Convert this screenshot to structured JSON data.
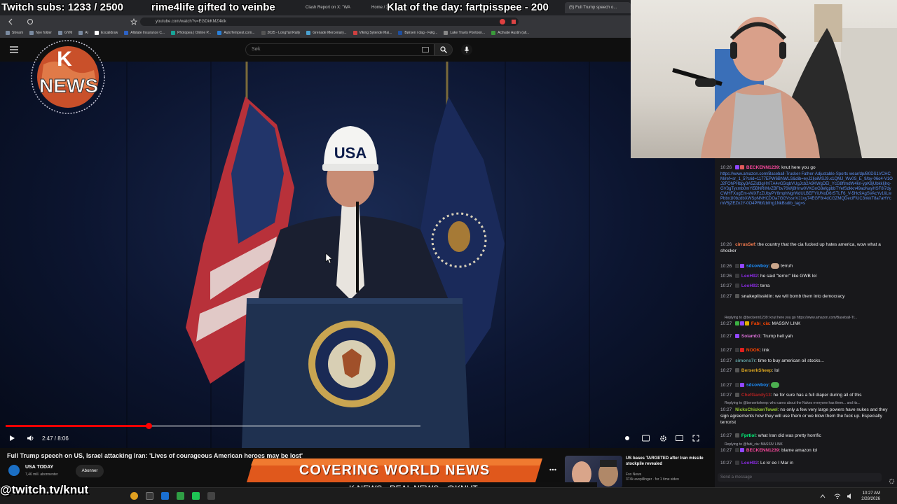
{
  "browser": {
    "tabs": [
      {
        "label": "Clash Report on X: \"WA"
      },
      {
        "label": "Home / X"
      },
      {
        "label": "(5) Full Trump speech o..."
      }
    ],
    "url": "youtube.com/watch?v=EGDkKMZ4klk",
    "bookmarks": [
      {
        "label": "Stream"
      },
      {
        "label": "Nye folder"
      },
      {
        "label": "GYM"
      },
      {
        "label": "AI"
      },
      {
        "label": "Excalidraw"
      },
      {
        "label": "Allstate Insurance C..."
      },
      {
        "label": "Photopea | Online P..."
      },
      {
        "label": "AutoTempest.com..."
      },
      {
        "label": "2025 - LongTail Rally"
      },
      {
        "label": "Grenade Mercenary..."
      },
      {
        "label": "Viking Sytende Mai..."
      },
      {
        "label": "Børsen i dag - Følg..."
      },
      {
        "label": "Lake Travis Pontoon..."
      },
      {
        "label": "Activate Austin (all..."
      }
    ]
  },
  "youtube": {
    "search_placeholder": "Søk",
    "player": {
      "time": "2:47 / 8:06",
      "progress": 0.344
    },
    "video_title": "Full Trump speech on US, Israel attacking Iran: 'Lives of courageous American heroes may be lost'",
    "channel": {
      "name": "USA TODAY",
      "subs": "7,46 mill. abonnenter"
    },
    "subscribe_label": "Abonner",
    "related": {
      "title": "US bases TARGETED after Iran missile stockpile revealed",
      "channel": "Fox News",
      "meta": "374k avspillinger · for 1 time siden"
    }
  },
  "overlays": {
    "subs_counter": "Twitch subs: 1233 / 2500",
    "gift_ticker": "rime4life gifted to veinbe",
    "klat": "Klat of the day: fartpisspee - 200",
    "logo_k": "K",
    "logo_news": "NEWS",
    "banner": "COVERING WORLD NEWS",
    "subbanner": "K NEWS - REAL NEWS - @KNUT",
    "twitch_handle": "@twitch.tv/knut",
    "hat_text": "USA"
  },
  "chat": {
    "messages": [
      {
        "time": "10:26",
        "user": "BECKENN1239",
        "color": "#ff4aa0",
        "text": "knut here you go"
      },
      {
        "time": "",
        "user": "",
        "color": "#5c8ff2",
        "text": "https://www.amazon.com/Baseball-Trucker-Father-Adjustable-Sports wear/dp/B0DS1VCHCM/ref=sr_1_5?crid=1177EPW6BNWLS&dib=eyJ2IjoiMSJ9.x1QMJ_Wv0S_E_9/by-06o4-V1OJ2FOhPHbpy3A5Zid3qHYi7A4vG5tqbVUgJcb2A9KWgDEl_YcG8ftmdW4kri-ypK8jUbkkIjIrq-GV3gTyxmb0mYi5BNRIMvZBFbv76Wj8Hnw0VKGnG8efgpbbTYefSdkkn49aoNayHSF8i7dyCWHFXugEm-vMXFzZUbyPY8mphNgrWdULBEFYiUNoD6rSTLF6_V-5Hc9AgSVAcYv1IiLwPbbx1l0bzdbXWSpNNHCDOa7GGVssnVJ1vy74EGF8r4dCGZMQDeciFiUC3nkkT8a7aHYcmV5jZEZn2Y-0O4PRbfzbfrrg1NkBsdib_tag=s"
      },
      {
        "time": "10:26",
        "user": "cirrusSef",
        "color": "#ff7f50",
        "text": "the country that the cia fucked up hates america, wow what a shocker"
      },
      {
        "time": "10:26",
        "user": "sdcowboy",
        "color": "#1e90ff",
        "text": "terruh"
      },
      {
        "time": "10:26",
        "user": "LeoH92",
        "color": "#8a2be2",
        "text": "he said \"terror\" like GWB lol"
      },
      {
        "time": "10:27",
        "user": "LeoH92",
        "color": "#8a2be2",
        "text": "terra"
      },
      {
        "time": "10:27",
        "user": "snakeplisskiin",
        "color": "#b0b0b0",
        "text": "we will bomb them into democracy"
      },
      {
        "time": "",
        "user": "",
        "color": "#adadb8",
        "text": "Replying to @beckenn1239: knut here you go https://www.amazon.com/Baseball-Tr..."
      },
      {
        "time": "10:27",
        "user": "Fabi_cia",
        "color": "#ff4500",
        "text": "MASSIV LINK"
      },
      {
        "time": "10:27",
        "user": "Solamb1",
        "color": "#da70d6",
        "text": "Trump hell yah"
      },
      {
        "time": "10:27",
        "user": "NOOK",
        "color": "#ff4500",
        "text": "link"
      },
      {
        "time": "10:27",
        "user": "simons7r",
        "color": "#5f9ea0",
        "text": "time to buy american oil stocks..."
      },
      {
        "time": "10:27",
        "user": "BerserkSheep",
        "color": "#daa520",
        "text": "lol"
      },
      {
        "time": "10:27",
        "user": "sdcowboy",
        "color": "#1e90ff",
        "text": ""
      },
      {
        "time": "10:27",
        "user": "ChefGandy13",
        "color": "#b22222",
        "text": "he for sure has a full diaper during all of this"
      },
      {
        "time": "",
        "user": "",
        "color": "#adadb8",
        "text": "Replying to @berserksheep: who cares about the Nukes everyone has them... and its..."
      },
      {
        "time": "10:27",
        "user": "NicksChickenTowel",
        "color": "#9acd32",
        "text": "no only a few very large powers have nukes and they sign agreements how they will use them or we blow them the fuck up. Especially terrorist"
      },
      {
        "time": "10:27",
        "user": "Fprtiol",
        "color": "#00ff7f",
        "text": "what Iran did was pretty horrific"
      },
      {
        "time": "",
        "user": "",
        "color": "#adadb8",
        "text": "Replying to @fabi_cia: MASSIV LINK"
      },
      {
        "time": "10:27",
        "user": "BECKENN1239",
        "color": "#ff4aa0",
        "text": "blame amazon lol"
      },
      {
        "time": "10:27",
        "user": "LeoH92",
        "color": "#8a2be2",
        "text": "Lo kr ee I Mar in"
      }
    ],
    "input_placeholder": "Send a message"
  },
  "taskbar": {
    "time": "10:27 AM",
    "date": "2/28/2026"
  }
}
